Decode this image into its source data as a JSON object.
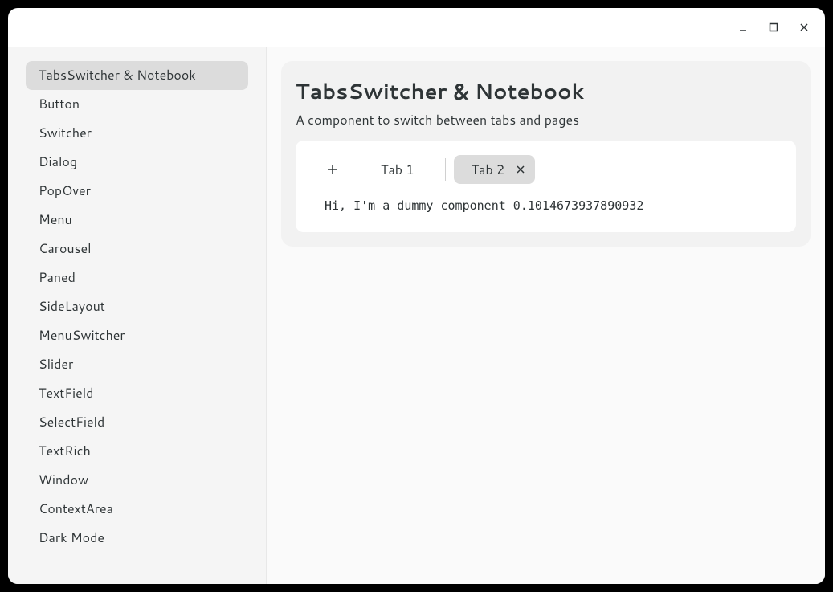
{
  "sidebar": {
    "items": [
      {
        "label": "TabsSwitcher & Notebook",
        "active": true
      },
      {
        "label": "Button",
        "active": false
      },
      {
        "label": "Switcher",
        "active": false
      },
      {
        "label": "Dialog",
        "active": false
      },
      {
        "label": "PopOver",
        "active": false
      },
      {
        "label": "Menu",
        "active": false
      },
      {
        "label": "Carousel",
        "active": false
      },
      {
        "label": "Paned",
        "active": false
      },
      {
        "label": "SideLayout",
        "active": false
      },
      {
        "label": "MenuSwitcher",
        "active": false
      },
      {
        "label": "Slider",
        "active": false
      },
      {
        "label": "TextField",
        "active": false
      },
      {
        "label": "SelectField",
        "active": false
      },
      {
        "label": "TextRich",
        "active": false
      },
      {
        "label": "Window",
        "active": false
      },
      {
        "label": "ContextArea",
        "active": false
      },
      {
        "label": "Dark Mode",
        "active": false
      }
    ]
  },
  "main": {
    "title": "TabsSwitcher & Notebook",
    "subtitle": "A component to switch between tabs and pages",
    "tabs": [
      {
        "label": "Tab 1",
        "active": false
      },
      {
        "label": "Tab 2",
        "active": true
      }
    ],
    "content": "Hi, I'm a dummy component 0.1014673937890932"
  }
}
